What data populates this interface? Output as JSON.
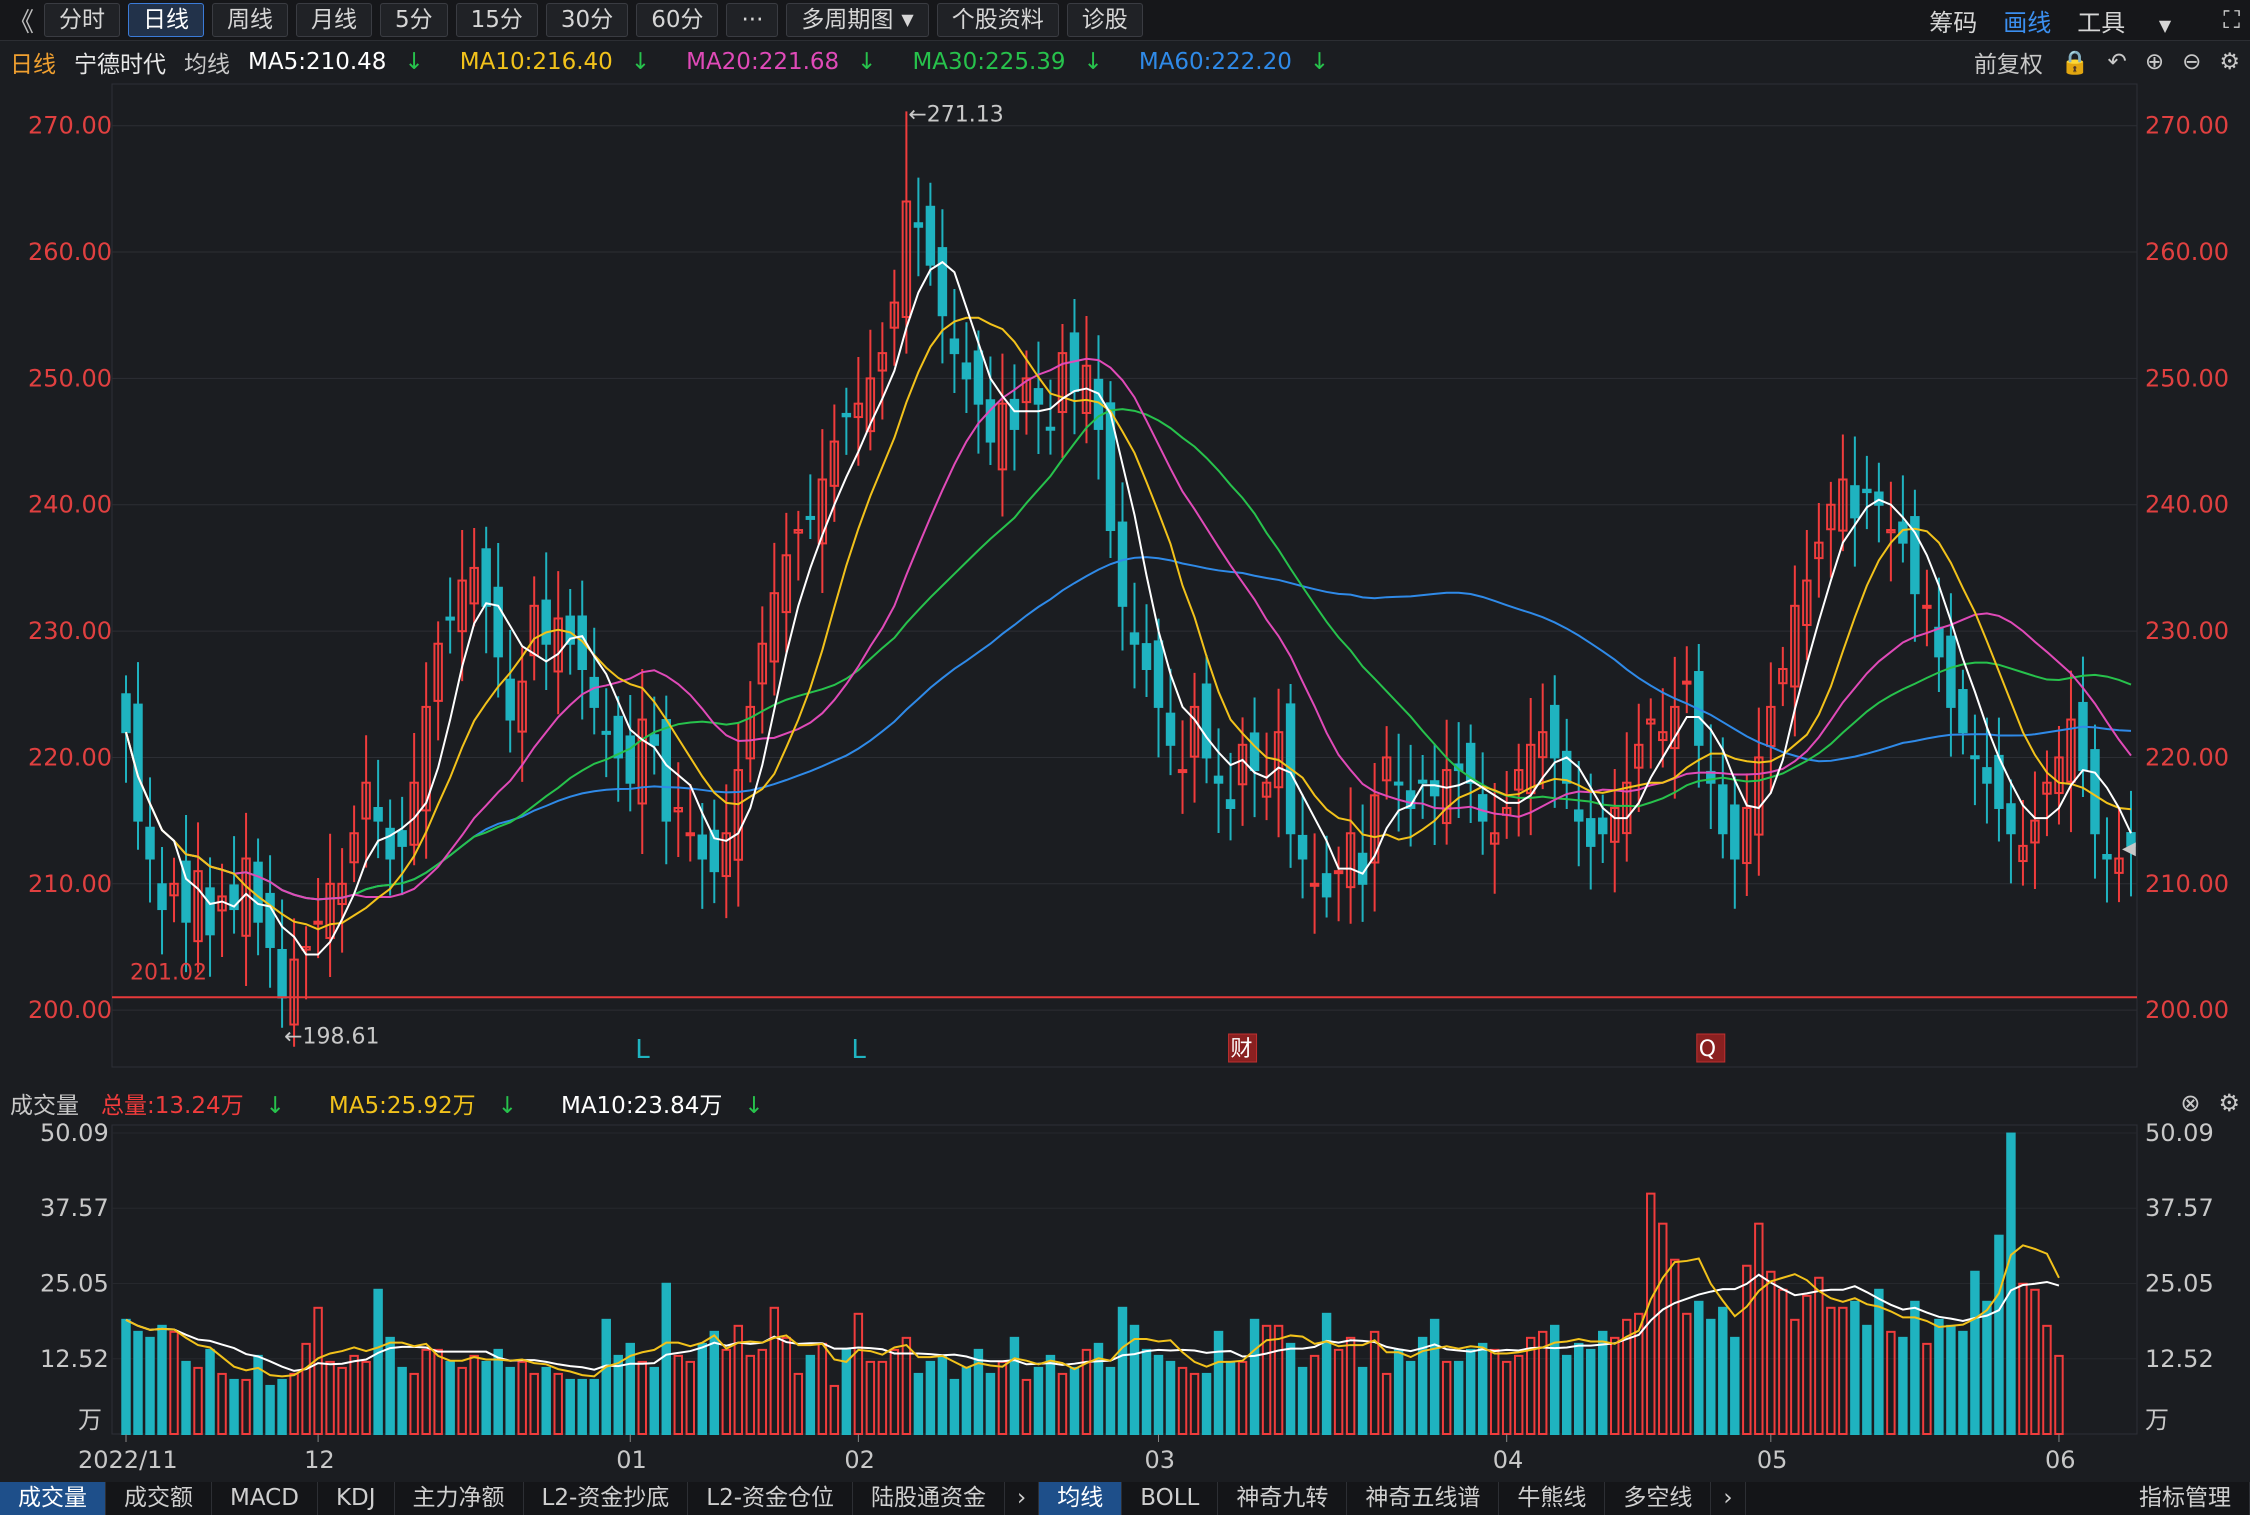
{
  "toolbar": {
    "back": "《",
    "periods": [
      "分时",
      "日线",
      "周线",
      "月线",
      "5分",
      "15分",
      "30分",
      "60分"
    ],
    "active": "日线",
    "more": "···",
    "extra": [
      "多周期图",
      "个股资料",
      "诊股"
    ],
    "right": [
      "筹码",
      "画线",
      "工具"
    ]
  },
  "legend": {
    "period": "日线",
    "stock": "宁德时代",
    "ma_label": "均线",
    "items": [
      "MA5:210.48",
      "MA10:216.40",
      "MA20:221.68",
      "MA30:225.39",
      "MA60:222.20"
    ],
    "arrow": "↓",
    "adjust": "前复权"
  },
  "colors": {
    "up": "#f03c3c",
    "down": "#1fb3c0",
    "ma5": "#ffffff",
    "ma10": "#f2c21b",
    "ma20": "#e04ab8",
    "ma30": "#27c24c",
    "ma60": "#2f8ae8"
  },
  "chart_data": {
    "type": "candlestick",
    "price_axis": {
      "ticks": [
        "270.00",
        "260.00",
        "250.00",
        "240.00",
        "230.00",
        "220.00",
        "210.00",
        "200.00"
      ],
      "ylim": [
        195.5,
        273.3
      ]
    },
    "date_ticks": [
      "2022/11",
      "12",
      "01",
      "02",
      "03",
      "04",
      "05",
      "06"
    ],
    "date_tick_index": [
      0,
      16,
      42,
      61,
      86,
      115,
      137,
      161
    ],
    "annotations": {
      "high": "←271.13",
      "low": "←198.61",
      "level": "201.02",
      "level_value": 201.02
    },
    "markers": [
      {
        "label": "L",
        "index": 43
      },
      {
        "label": "L",
        "index": 61
      },
      {
        "label": "财",
        "index": 93
      },
      {
        "label": "Q",
        "index": 132
      }
    ],
    "close": [
      222,
      215,
      212,
      208,
      210,
      207,
      211,
      206,
      209,
      208,
      212,
      207,
      205,
      201,
      204,
      205,
      207,
      210,
      210,
      214,
      218,
      215,
      212,
      213,
      218,
      224,
      229,
      231,
      234,
      235,
      232,
      228,
      223,
      226,
      232,
      229,
      231,
      229,
      227,
      224,
      222,
      220,
      218,
      223,
      221,
      215,
      216,
      214,
      212,
      211,
      214,
      219,
      224,
      229,
      233,
      236,
      238,
      239,
      242,
      245,
      247,
      248,
      250,
      252,
      256,
      264,
      262,
      259,
      255,
      252,
      250,
      248,
      245,
      248,
      246,
      250,
      248,
      246,
      252,
      249,
      251,
      246,
      238,
      232,
      229,
      227,
      224,
      221,
      219,
      224,
      220,
      218,
      216,
      221,
      219,
      218,
      222,
      214,
      212,
      210,
      209,
      211,
      214,
      210,
      217,
      220,
      218,
      216,
      218,
      217,
      219,
      219,
      218,
      215,
      214,
      216,
      219,
      221,
      222,
      220,
      218,
      215,
      213,
      214,
      216,
      218,
      221,
      223,
      222,
      224,
      226,
      221,
      218,
      214,
      212,
      216,
      220,
      224,
      227,
      232,
      234,
      237,
      240,
      242,
      239,
      241,
      240,
      238,
      237,
      233,
      232,
      228,
      224,
      222,
      220,
      218,
      216,
      214,
      213,
      215,
      218,
      220,
      223,
      219,
      214,
      212,
      212,
      213
    ],
    "vol_axis": {
      "ticks": [
        "50.09",
        "37.57",
        "25.05",
        "12.52"
      ],
      "unit": "万",
      "ylim": [
        0,
        50.09
      ]
    },
    "volume": [
      19,
      17,
      16,
      18,
      17,
      12,
      11,
      14,
      10,
      9,
      9,
      13,
      8,
      9,
      10,
      15,
      21,
      12,
      11,
      13,
      12,
      24,
      16,
      11,
      10,
      14,
      14,
      12,
      11,
      13,
      12,
      14,
      11,
      12,
      10,
      11,
      10,
      9,
      9,
      9,
      19,
      13,
      15,
      12,
      11,
      25,
      13,
      12,
      15,
      17,
      14,
      18,
      13,
      14,
      21,
      16,
      10,
      13,
      15,
      8,
      14,
      20,
      12,
      12,
      14,
      16,
      10,
      12,
      13,
      9,
      11,
      14,
      10,
      12,
      16,
      9,
      11,
      13,
      10,
      11,
      14,
      15,
      11,
      21,
      18,
      14,
      13,
      12,
      11,
      10,
      10,
      17,
      12,
      12,
      19,
      18,
      18,
      15,
      11,
      13,
      20,
      14,
      16,
      11,
      17,
      10,
      14,
      12,
      16,
      19,
      12,
      12,
      14,
      15,
      14,
      12,
      13,
      16,
      17,
      18,
      13,
      15,
      14,
      17,
      16,
      19,
      20,
      40,
      35,
      29,
      20,
      22,
      19,
      21,
      16,
      28,
      35,
      27,
      24,
      19,
      23,
      26,
      21,
      21,
      22,
      18,
      24,
      17,
      16,
      22,
      15,
      19,
      18,
      17,
      27,
      22,
      33,
      50,
      25,
      24,
      18,
      13
    ],
    "vol_ma": {
      "ma5": "MA5:25.92万",
      "ma10": "MA10:23.84万",
      "total": "总量:13.24万"
    }
  },
  "volume_panel": {
    "label": "成交量",
    "total": "总量:13.24万",
    "ma5": "MA5:25.92万",
    "ma10": "MA10:23.84万",
    "arrow": "↓"
  },
  "tabs": [
    "成交量",
    "成交额",
    "MACD",
    "KDJ",
    "主力净额",
    "L2-资金抄底",
    "L2-资金仓位",
    "陆股通资金",
    "均线",
    "BOLL",
    "神奇九转",
    "神奇五线谱",
    "牛熊线",
    "多空线",
    "指标管理"
  ],
  "active_tabs": [
    "成交量",
    "均线"
  ]
}
